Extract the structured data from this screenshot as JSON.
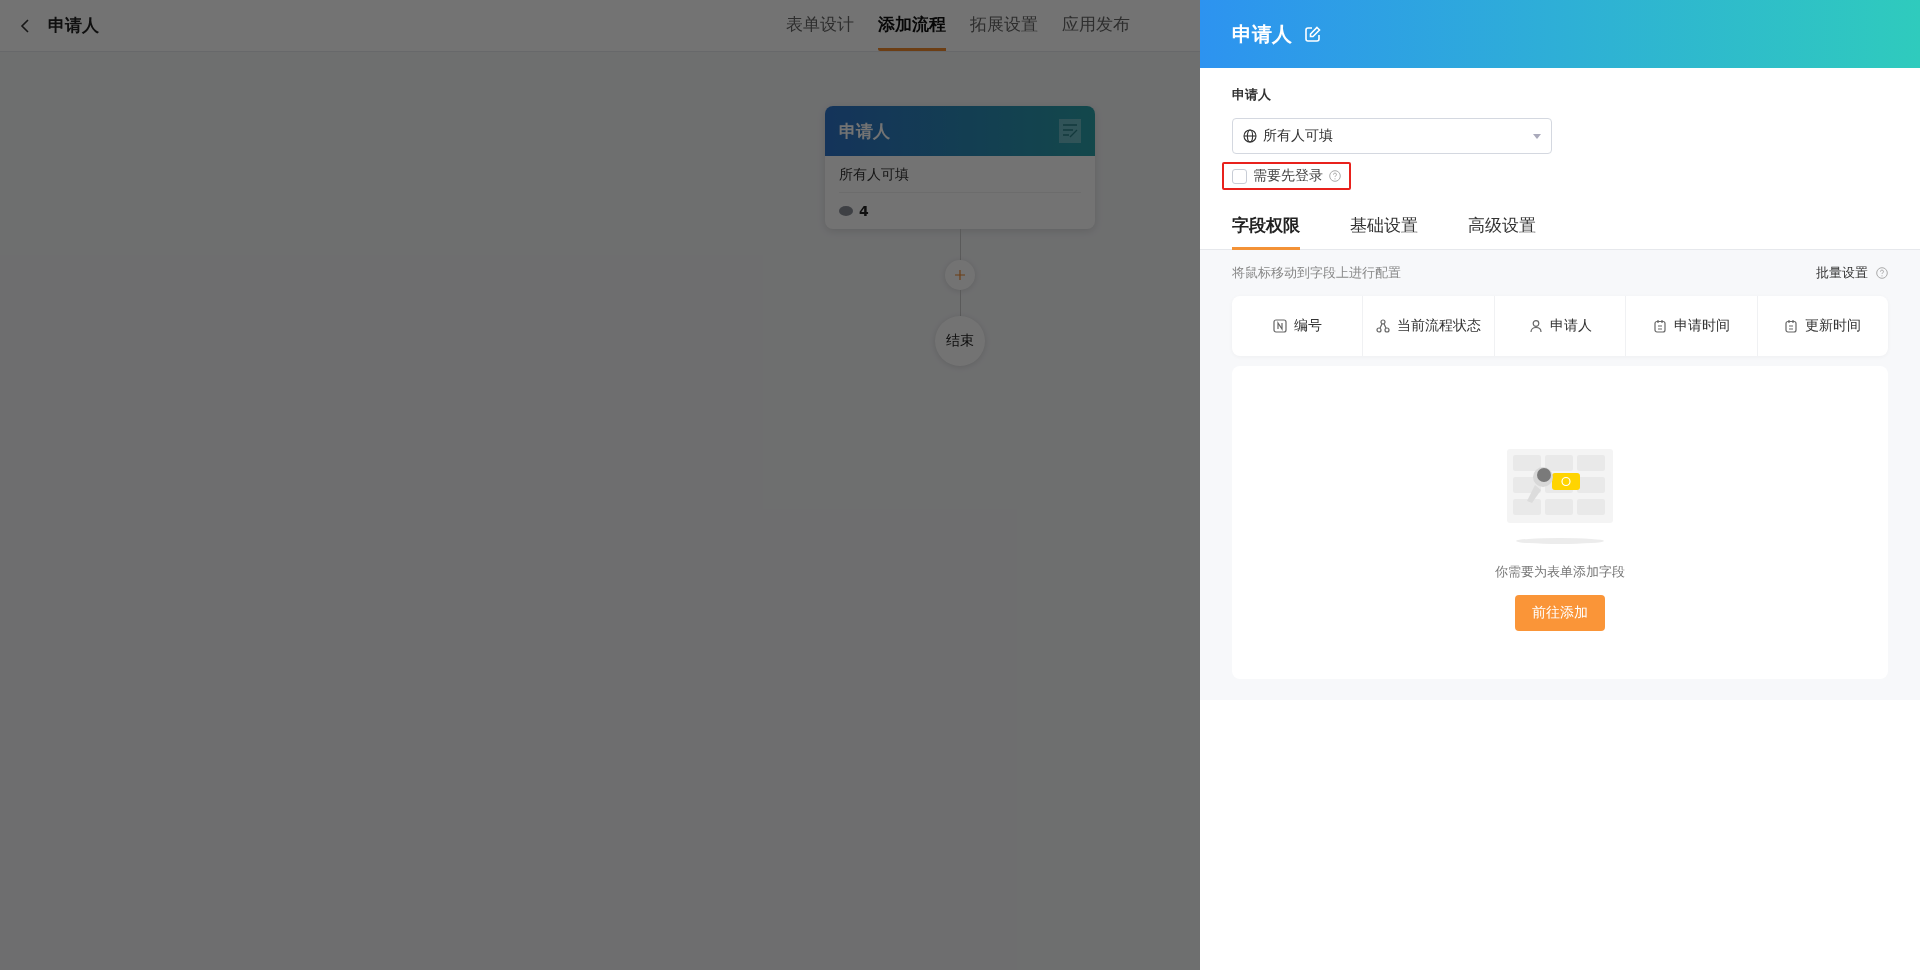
{
  "header": {
    "title": "申请人",
    "tabs": [
      {
        "label": "表单设计",
        "selected": false
      },
      {
        "label": "添加流程",
        "selected": true
      },
      {
        "label": "拓展设置",
        "selected": false
      },
      {
        "label": "应用发布",
        "selected": false
      }
    ]
  },
  "flow": {
    "node": {
      "title": "申请人",
      "permission": "所有人可填",
      "count": "4"
    },
    "end": "结束"
  },
  "panel": {
    "title": "申请人",
    "applicant_label": "申请人",
    "select": {
      "value": "所有人可填"
    },
    "login_required": {
      "label": "需要先登录",
      "checked": false,
      "highlighted": true
    },
    "tabs": [
      {
        "label": "字段权限",
        "selected": true
      },
      {
        "label": "基础设置",
        "selected": false
      },
      {
        "label": "高级设置",
        "selected": false
      }
    ],
    "hint": "将鼠标移动到字段上进行配置",
    "batch": "批量设置",
    "fields": [
      {
        "label": "编号",
        "kind": "number"
      },
      {
        "label": "当前流程状态",
        "kind": "flow"
      },
      {
        "label": "申请人",
        "kind": "person"
      },
      {
        "label": "申请时间",
        "kind": "date"
      },
      {
        "label": "更新时间",
        "kind": "date"
      }
    ],
    "empty": {
      "message": "你需要为表单添加字段",
      "button": "前往添加"
    }
  }
}
